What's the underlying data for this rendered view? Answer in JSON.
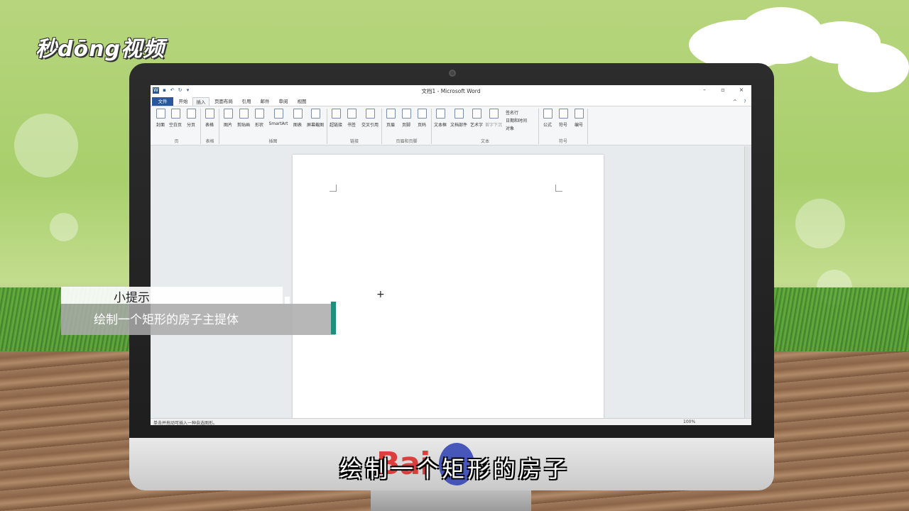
{
  "logo": {
    "text": "秒dōng视频"
  },
  "word": {
    "window_title": "文档1 - Microsoft Word",
    "tabs": [
      "文件",
      "开始",
      "插入",
      "页面布局",
      "引用",
      "邮件",
      "审阅",
      "视图"
    ],
    "ribbon_buttons": [
      {
        "label": "封面",
        "icon": "cover-icon"
      },
      {
        "label": "空白页",
        "icon": "blank-page-icon"
      },
      {
        "label": "分页",
        "icon": "page-break-icon"
      },
      {
        "label": "表格",
        "icon": "table-icon"
      },
      {
        "label": "图片",
        "icon": "picture-icon"
      },
      {
        "label": "剪贴画",
        "icon": "clipart-icon"
      },
      {
        "label": "形状",
        "icon": "shapes-icon"
      },
      {
        "label": "SmartArt",
        "icon": "smartart-icon"
      },
      {
        "label": "图表",
        "icon": "chart-icon"
      },
      {
        "label": "屏幕截图",
        "icon": "screenshot-icon"
      },
      {
        "label": "超链接",
        "icon": "hyperlink-icon"
      },
      {
        "label": "书签",
        "icon": "bookmark-icon"
      },
      {
        "label": "交叉引用",
        "icon": "cross-reference-icon"
      },
      {
        "label": "页眉",
        "icon": "header-icon"
      },
      {
        "label": "页脚",
        "icon": "footer-icon"
      },
      {
        "label": "页码",
        "icon": "page-number-icon"
      },
      {
        "label": "文本框",
        "icon": "textbox-icon"
      },
      {
        "label": "文档部件",
        "icon": "quick-parts-icon"
      },
      {
        "label": "艺术字",
        "icon": "wordart-icon"
      },
      {
        "label": "首字下沉",
        "icon": "drop-cap-icon"
      },
      {
        "label": "公式",
        "icon": "equation-icon"
      },
      {
        "label": "符号",
        "icon": "symbol-icon"
      },
      {
        "label": "编号",
        "icon": "number-icon"
      }
    ],
    "small_items": [
      "签名行",
      "日期和时间",
      "对象"
    ],
    "groups": [
      "页",
      "表格",
      "插图",
      "链接",
      "页眉和页脚",
      "文本",
      "符号"
    ],
    "status_text": "单击并拖动可插入一种自选图形。",
    "zoom": "100%"
  },
  "tip": {
    "heading": "小提示",
    "body": "绘制一个矩形的房子主提体"
  },
  "subtitle": "绘制一个矩形的房子",
  "watermark": "Bai"
}
